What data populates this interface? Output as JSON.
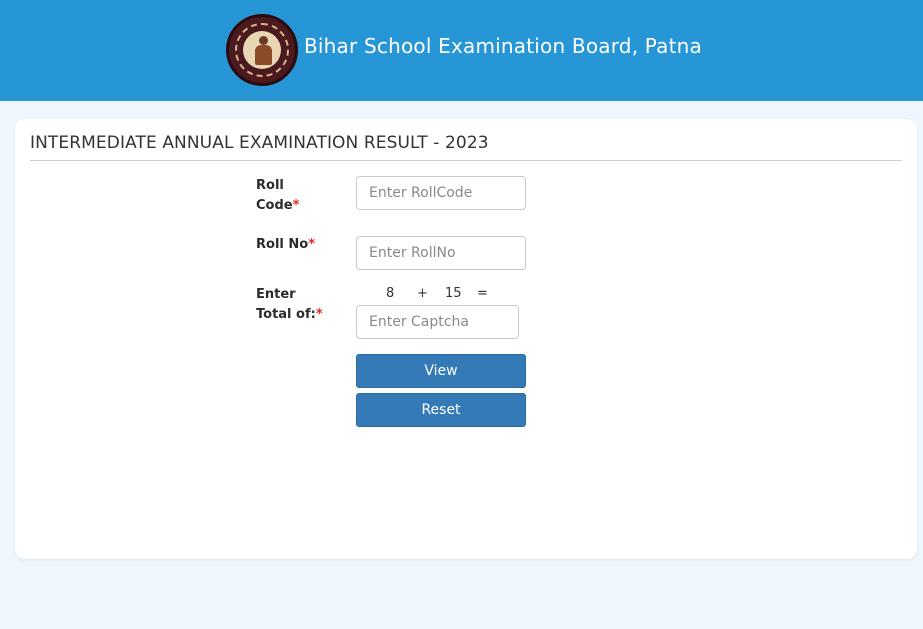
{
  "header": {
    "title": "Bihar School Examination Board, Patna",
    "logo_icon": "bseb-seal-logo",
    "background_color": "#2796d6"
  },
  "card": {
    "title": "INTERMEDIATE ANNUAL EXAMINATION RESULT - 2023"
  },
  "form": {
    "roll_code": {
      "label_line1": "Roll",
      "label_line2": "Code",
      "required_mark": "*",
      "placeholder": "Enter RollCode",
      "value": ""
    },
    "roll_no": {
      "label": "Roll No",
      "required_mark": "*",
      "placeholder": "Enter RollNo",
      "value": ""
    },
    "captcha": {
      "label_line1": "Enter",
      "label_line2": "Total of:",
      "required_mark": "*",
      "operand1": "8",
      "operator": "+",
      "operand2": "15",
      "equals": "=",
      "placeholder": "Enter Captcha",
      "value": ""
    },
    "view_label": "View",
    "reset_label": "Reset",
    "button_color": "#337ab7",
    "required_color": "#e02424"
  }
}
